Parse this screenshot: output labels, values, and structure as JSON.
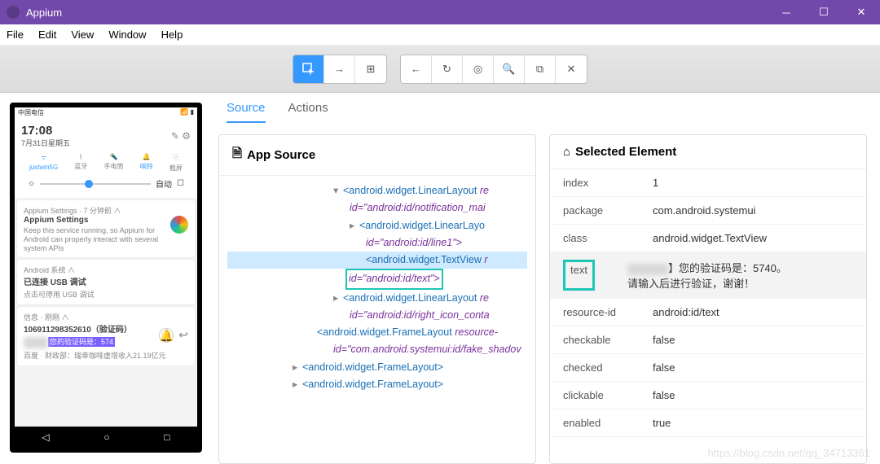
{
  "window": {
    "title": "Appium"
  },
  "menu": {
    "file": "File",
    "edit": "Edit",
    "view": "View",
    "window": "Window",
    "help": "Help"
  },
  "tabs": {
    "source": "Source",
    "actions": "Actions"
  },
  "panels": {
    "app_source": "App Source",
    "selected_element": "Selected Element"
  },
  "tree": {
    "l1_tag": "<android.widget.LinearLayout",
    "l1_attr": "re",
    "l1b": "id=\"android:id/notification_mai",
    "l2_tag": "<android.widget.LinearLayo",
    "l2b": "id=\"android:id/line1\">",
    "l3_tag": "<android.widget.TextView",
    "l3_attr": "r",
    "l3b": "id=\"android:id/text\">",
    "l4_tag": "<android.widget.LinearLayout",
    "l4_attr": "re",
    "l4b": "id=\"android:id/right_icon_conta",
    "l5_tag": "<android.widget.FrameLayout",
    "l5_attr": "resource-",
    "l5b": "id=\"com.android.systemui:id/fake_shadov",
    "l6": "<android.widget.FrameLayout>",
    "l7": "<android.widget.FrameLayout>"
  },
  "props": {
    "index_k": "index",
    "index_v": "1",
    "package_k": "package",
    "package_v": "com.android.systemui",
    "class_k": "class",
    "class_v": "android.widget.TextView",
    "text_k": "text",
    "text_v1": "】您的验证码是：5740。",
    "text_v2": "请输入后进行验证，谢谢！",
    "resid_k": "resource-id",
    "resid_v": "android:id/text",
    "checkable_k": "checkable",
    "checkable_v": "false",
    "checked_k": "checked",
    "checked_v": "false",
    "clickable_k": "clickable",
    "clickable_v": "false",
    "enabled_k": "enabled",
    "enabled_v": "true"
  },
  "phone": {
    "carrier": "中国电信",
    "time": "17:08",
    "date": "7月31日星期五",
    "qs": {
      "wifi": "justwin5G",
      "bt": "蓝牙",
      "torch": "手电筒",
      "ring": "响铃",
      "shot": "截屏"
    },
    "auto": "自动",
    "card1_head": "Appium Settings · 7 分钟前 ∧",
    "card1_title": "Appium Settings",
    "card1_body": "Keep this service running, so Appium for Android can properly interact with several system APIs",
    "card2_head": "Android 系统 ∧",
    "card2_title": "已连接 USB 调试",
    "card2_body": "点击可停用 USB 调试",
    "card3_head": "信息 · 刚刚 ∧",
    "card3_title": "106911298352610（验证码）",
    "card3_sms": "您的验证码是：574",
    "card3_foot": "百度 · 财政部：瑞幸咖啡虚增收入21.19亿元"
  },
  "watermark": "https://blog.csdn.net/qq_34713361"
}
